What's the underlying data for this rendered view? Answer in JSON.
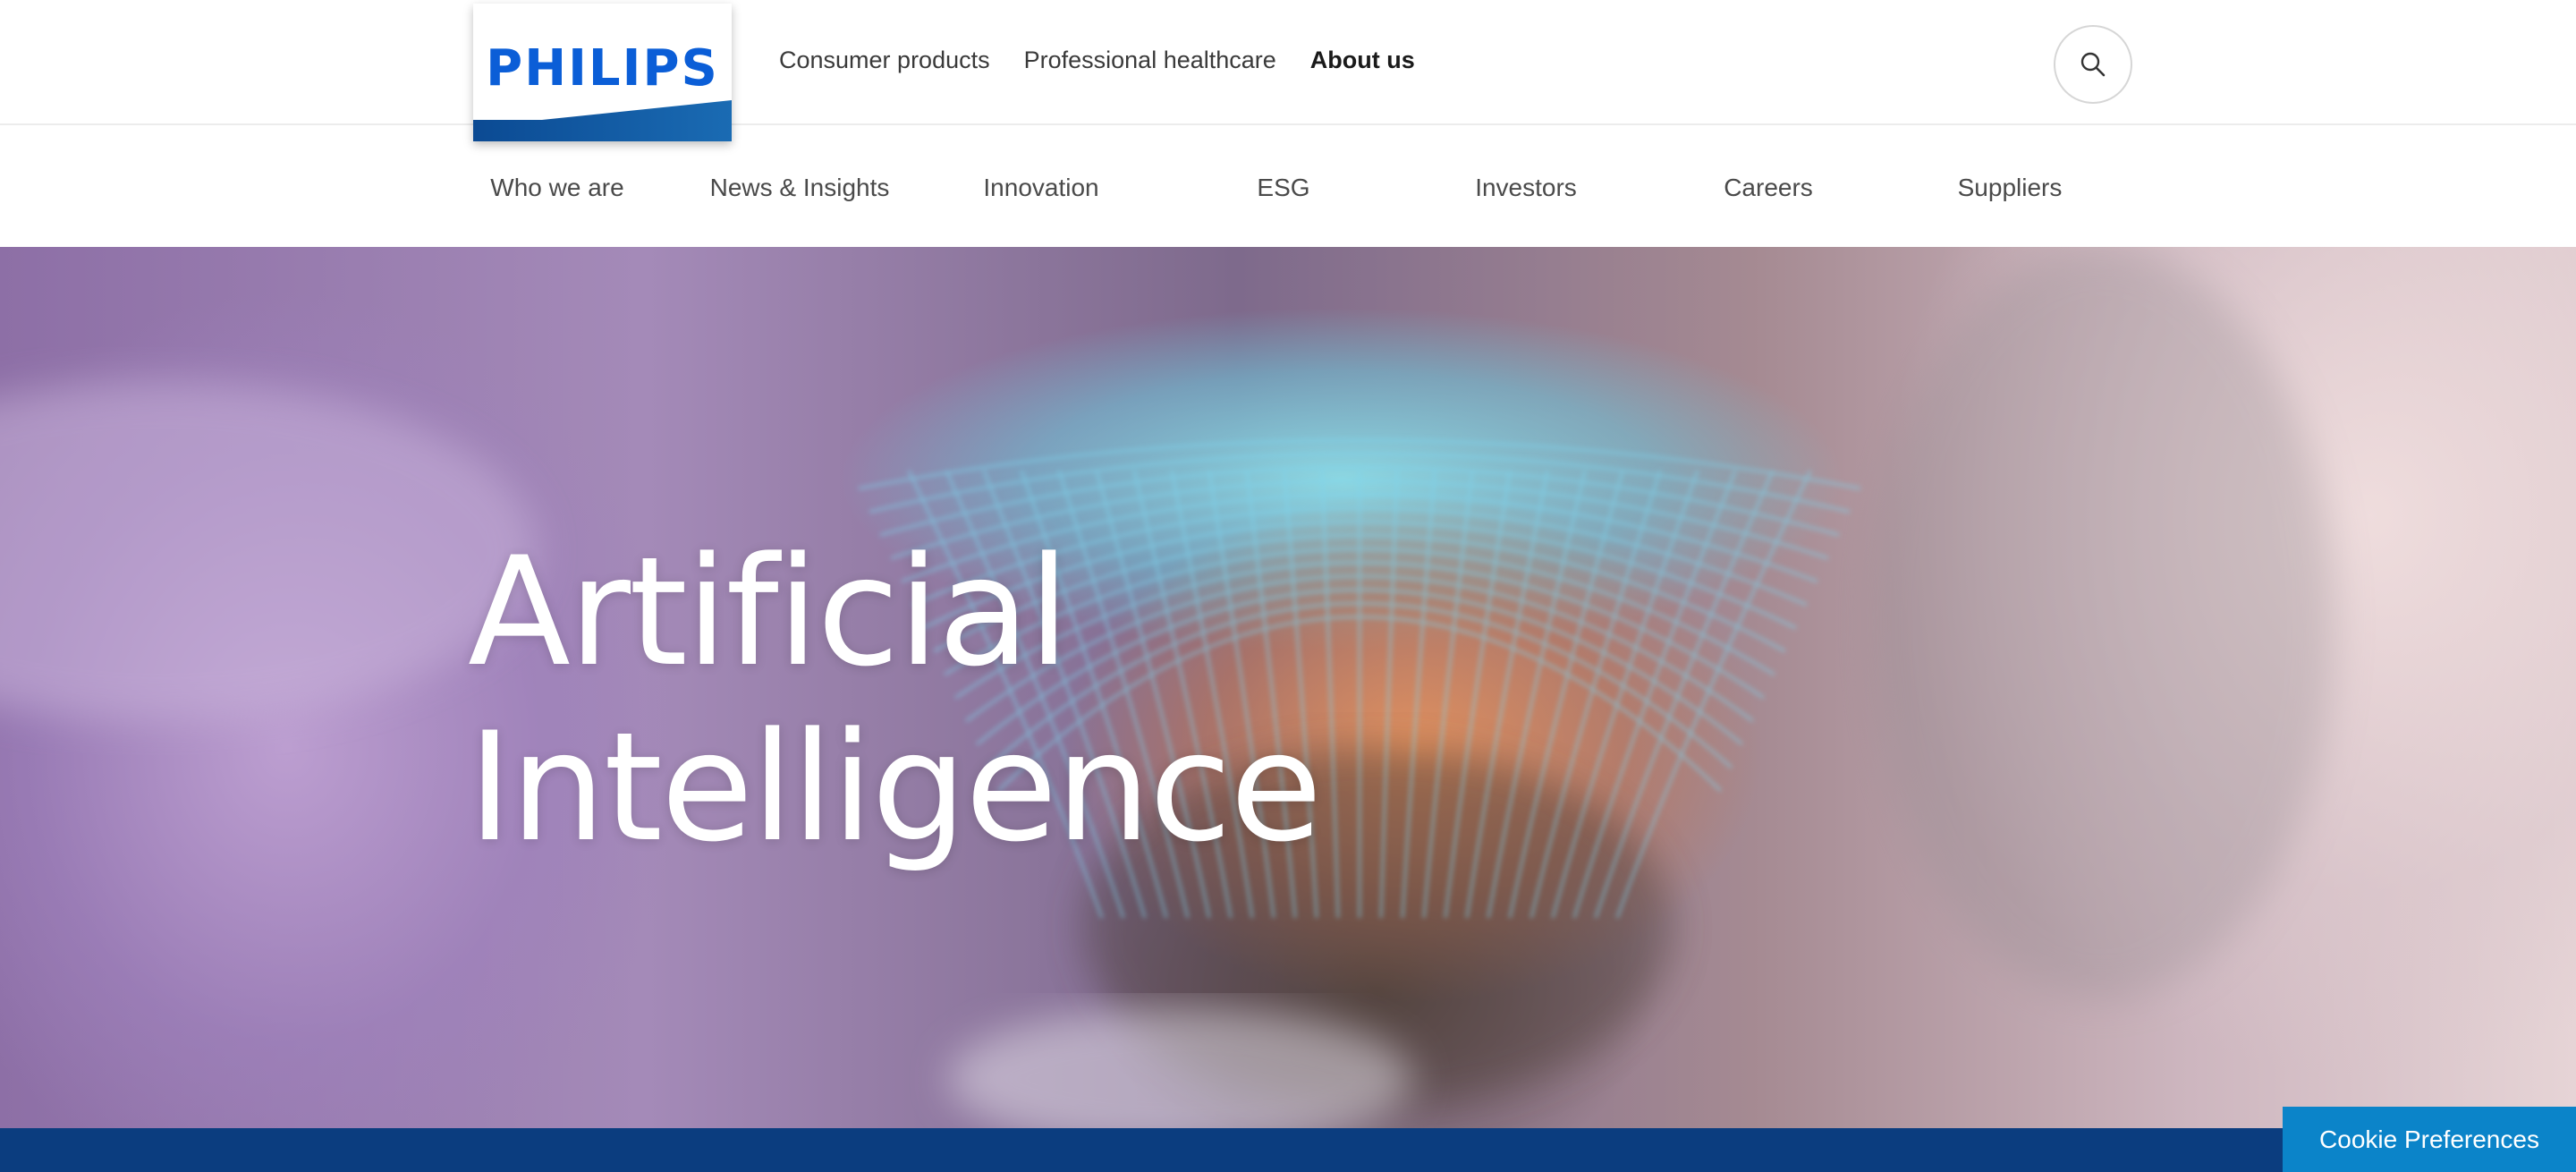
{
  "brand": {
    "logo_text": "PHILIPS",
    "logo_color": "#0b5ed7",
    "band_color": "#0b4a93"
  },
  "primary_nav": {
    "items": [
      {
        "label": "Consumer products",
        "active": false
      },
      {
        "label": "Professional healthcare",
        "active": false
      },
      {
        "label": "About us",
        "active": true
      }
    ]
  },
  "search": {
    "icon": "search-icon"
  },
  "sub_nav": {
    "items": [
      {
        "label": "Who we are"
      },
      {
        "label": "News & Insights"
      },
      {
        "label": "Innovation"
      },
      {
        "label": "ESG"
      },
      {
        "label": "Investors"
      },
      {
        "label": "Careers"
      },
      {
        "label": "Suppliers"
      }
    ]
  },
  "hero": {
    "title_line1": "Artificial",
    "title_line2": "Intelligence"
  },
  "cookie": {
    "label": "Cookie Preferences",
    "color": "#0b84c9"
  },
  "bottom_band": {
    "color": "#0b3d7f"
  }
}
